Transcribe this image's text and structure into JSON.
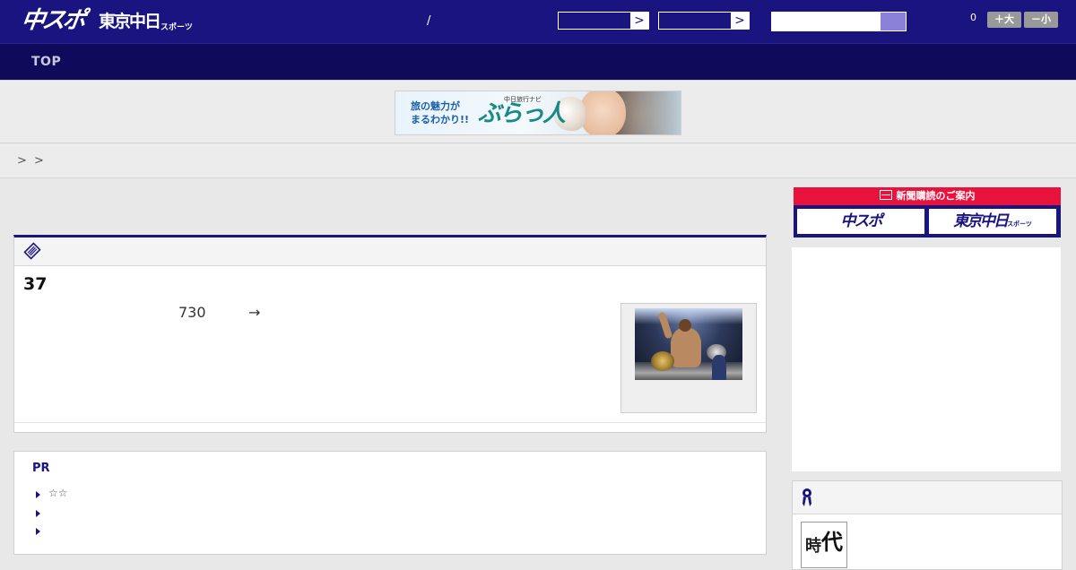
{
  "header": {
    "logo_primary": "中スポ",
    "logo_secondary": "東京中日",
    "logo_secondary_sub": "スポーツ",
    "slash": "/",
    "select1_arrow": ">",
    "select2_arrow": ">",
    "search_placeholder": "",
    "search_value": "",
    "count": "0",
    "font_large_label": "＋大",
    "font_small_label": "－小"
  },
  "nav": {
    "items": [
      {
        "label": "TOP"
      }
    ]
  },
  "banner": {
    "copy_line1": "旅の魅力が",
    "copy_line2": "まるわかり!!",
    "brand_sub": "中日旅行ナビ",
    "brand": "ぶらっ人"
  },
  "breadcrumb": {
    "separators": [
      ">",
      ">"
    ]
  },
  "article": {
    "title": "37",
    "body_number": "730",
    "body_arrow": "→",
    "icon": "newspaper-icon",
    "photo": "boxing-champion-photo"
  },
  "pr": {
    "title": "PR",
    "items": [
      {
        "label": "☆☆"
      },
      {
        "label": ""
      },
      {
        "label": ""
      }
    ]
  },
  "sidebar": {
    "subscribe_label": "新聞購読のご案内",
    "subscribe_icon": "mail-icon",
    "subscribe_buttons": [
      {
        "label": "中スポ",
        "sub": ""
      },
      {
        "label": "東京中日",
        "sub": "スポーツ"
      }
    ],
    "ranking_icon": "ribbon-icon",
    "jidai_text": "時代"
  },
  "colors": {
    "header_bg": "#1a1480",
    "nav_bg": "#0f0a5a",
    "accent_red": "#e8123c",
    "page_bg": "#e8e8e8"
  }
}
